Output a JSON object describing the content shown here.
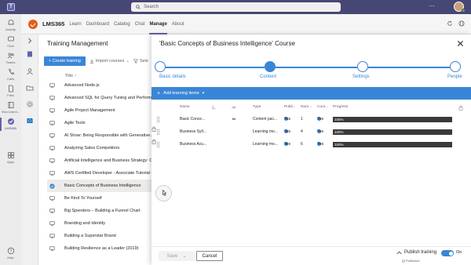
{
  "teams": {
    "search_placeholder": "Search",
    "dots": "···",
    "rail": [
      {
        "label": "Activity",
        "icon": "bell-icon"
      },
      {
        "label": "Chat",
        "icon": "chat-icon"
      },
      {
        "label": "Teams",
        "icon": "teams-icon"
      },
      {
        "label": "Calls",
        "icon": "phone-icon"
      },
      {
        "label": "Files",
        "icon": "file-icon"
      },
      {
        "label": "Viva Learni...",
        "icon": "book-icon"
      },
      {
        "label": "LMS365",
        "icon": "lms-icon"
      },
      {
        "label": "Apps",
        "icon": "apps-icon"
      },
      {
        "label": "Help",
        "icon": "help-icon"
      }
    ]
  },
  "app": {
    "name": "LMS365",
    "tabs": [
      "Learn",
      "Dashboard",
      "Catalog",
      "Chat",
      "Manage",
      "About"
    ],
    "active_tab": "Manage"
  },
  "list_panel": {
    "title": "Training Management",
    "create_button": "Create training",
    "import_label": "Import courses",
    "select_label": "Sele",
    "column_title": "Title",
    "rows": [
      "Advanced Node.js",
      "Advanced SQL for Query Tuning and Performa",
      "Agile Project Management",
      "Agile Tools",
      "AI Show: Being Responsible with Generative A",
      "Analyzing Sales Competitors",
      "Artificial Intelligence and Business Strategy: Co",
      "AWS Certified Developer - Associate Tutorial -",
      "Basic Concepts of Business Intelligence",
      "Be Kind To Yourself",
      "Big Spenders – Building a Funnel Chart",
      "Branding and Identity",
      "Building a Superstar Brand",
      "Building Resilience as a Leader (2019)"
    ],
    "selected_index": 8
  },
  "dialog": {
    "title": "'Basic Concepts of Business Intelligence' Course",
    "steps": [
      "Basic details",
      "Content",
      "Settings",
      "People"
    ],
    "current_step": 1,
    "add_items_label": "Add learning items",
    "columns": [
      "Name",
      "Type",
      "Publi...",
      "Num...",
      "Cour...",
      "Progress"
    ],
    "rows": [
      {
        "name": "Basic Conce...",
        "badge": "BI",
        "type": "Content pac...",
        "published": "Yes",
        "num": "1",
        "course": "Yes",
        "progress": "100%",
        "locked": false
      },
      {
        "name": "Business Syll...",
        "badge": "",
        "type": "Learning mo...",
        "published": "Yes",
        "num": "4",
        "course": "Yes",
        "progress": "100%",
        "locked": true
      },
      {
        "name": "Business Acu...",
        "badge": "",
        "type": "Learning mo...",
        "published": "Yes",
        "num": "6",
        "course": "Yes",
        "progress": "100%",
        "locked": true
      }
    ],
    "footer": {
      "save_label": "Save",
      "cancel_label": "Cancel",
      "publish_label": "Publish training",
      "published_status": "Published",
      "toggle_label": "On"
    }
  },
  "colors": {
    "teams_purple": "#464775",
    "accent_blue": "#3a86d6",
    "brand_orange": "#e35d1b"
  }
}
